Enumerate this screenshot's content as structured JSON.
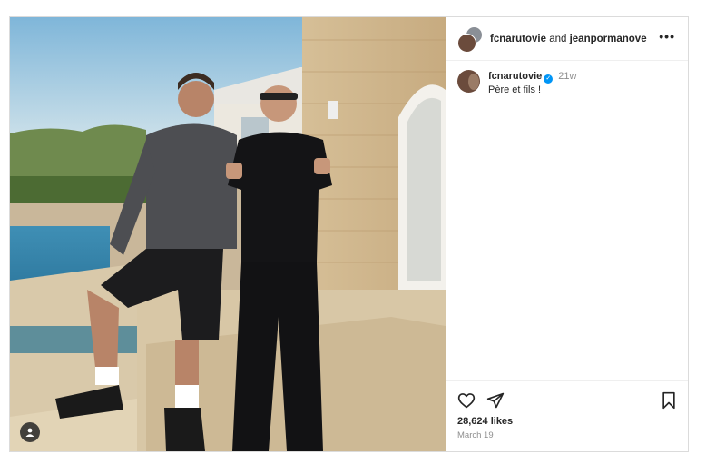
{
  "post": {
    "header": {
      "user1": "fcnarutovie",
      "conjunction": "and",
      "user2": "jeanpormanove",
      "more_icon": "more-horizontal-icon"
    },
    "caption": {
      "username": "fcnarutovie",
      "verified": true,
      "time": "21w",
      "text": "Père et fils !"
    },
    "actions": {
      "icons": [
        "heart-icon",
        "share-icon",
        "bookmark-icon"
      ]
    },
    "likes": "28,624 likes",
    "date": "March 19"
  },
  "colors": {
    "border": "#dbdbdb",
    "text": "#262626",
    "muted": "#8e8e8e",
    "verified": "#0095f6"
  }
}
